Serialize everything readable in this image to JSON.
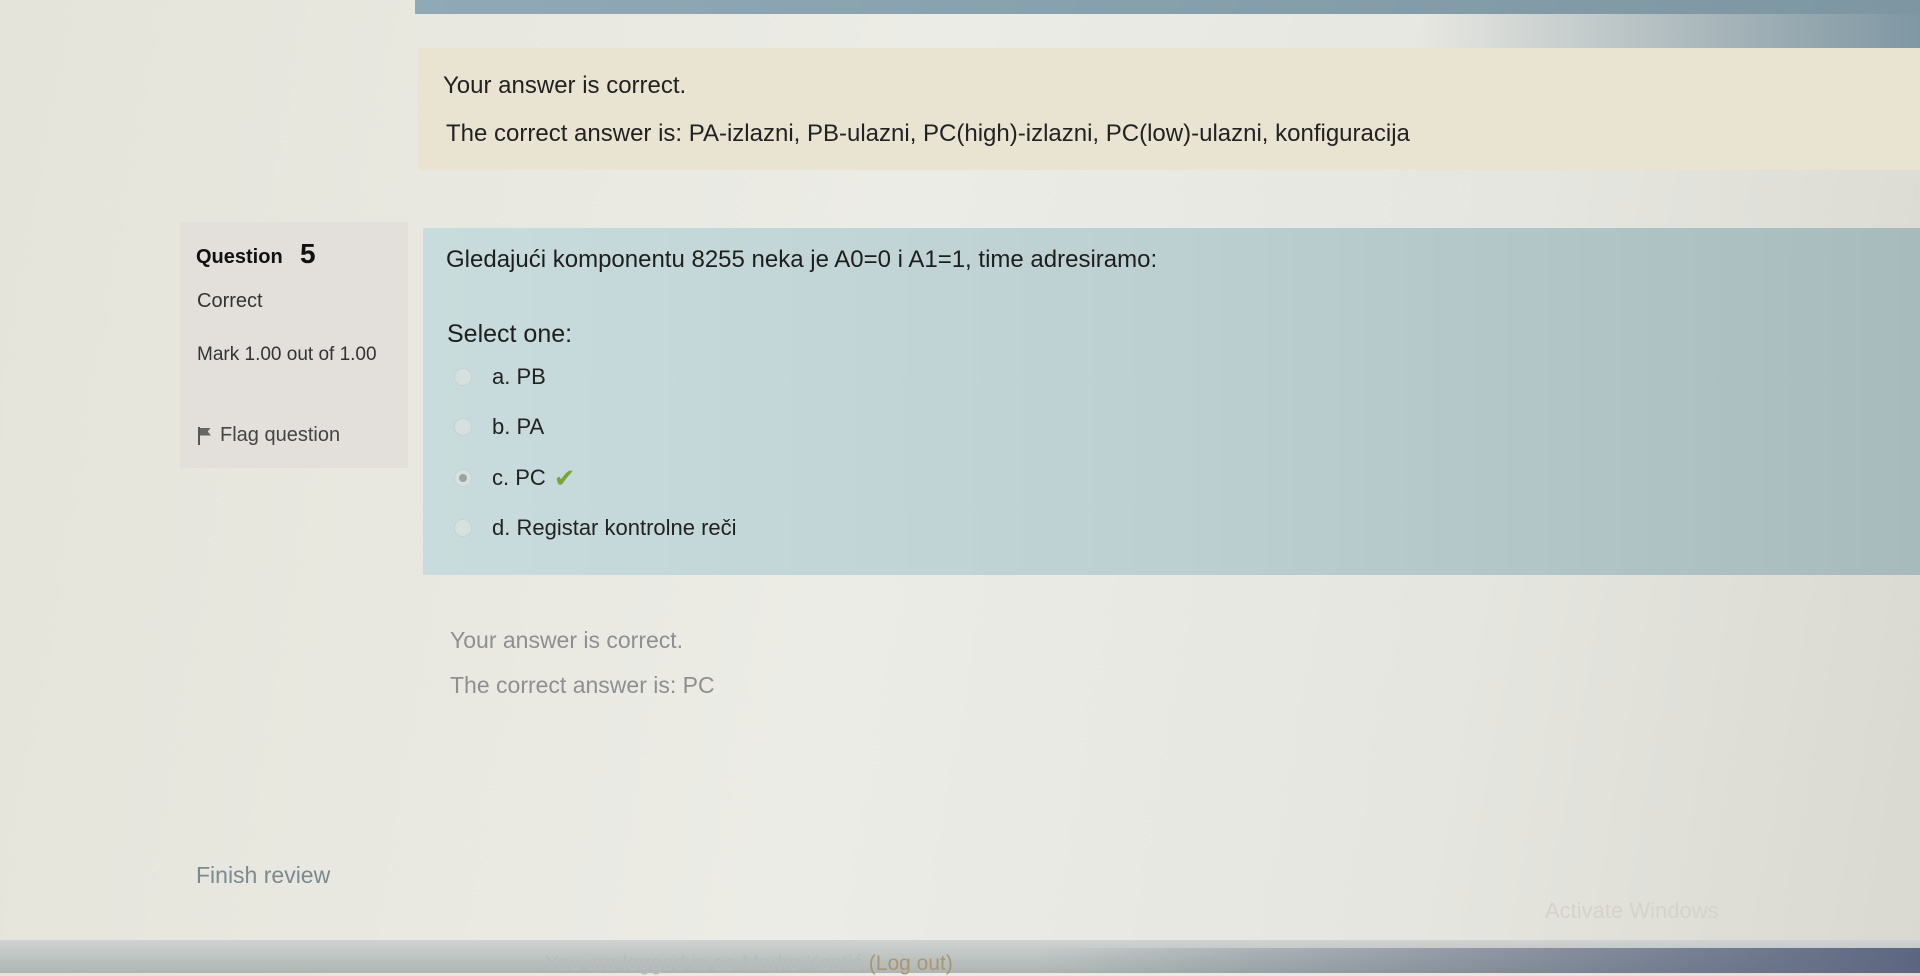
{
  "previous_feedback": {
    "result": "Your answer is correct.",
    "correct_answer": "The correct answer is: PA-izlazni, PB-ulazni, PC(high)-izlazni, PC(low)-ulazni, konfiguracija"
  },
  "question": {
    "label": "Question",
    "number": "5",
    "state": "Correct",
    "grade": "Mark 1.00 out of 1.00",
    "flag_label": "Flag question",
    "text": "Gledajući komponentu 8255 neka je A0=0 i A1=1, time adresiramo:",
    "prompt": "Select one:",
    "options": [
      {
        "label": "a. PB",
        "selected": false,
        "correct": false
      },
      {
        "label": "b. PA",
        "selected": false,
        "correct": false
      },
      {
        "label": "c. PC",
        "selected": true,
        "correct": true
      },
      {
        "label": "d. Registar kontrolne reči",
        "selected": false,
        "correct": false
      }
    ],
    "feedback": {
      "result": "Your answer is correct.",
      "correct_answer": "The correct answer is: PC"
    }
  },
  "finish_review_label": "Finish review",
  "footer": {
    "logged_in_prefix": "You are logged in as Marko Kostić",
    "logout_label": "(Log out)"
  },
  "watermark": "Activate Windows",
  "icons": {
    "flag": "flag-icon",
    "correct": "checkmark-icon"
  },
  "colors": {
    "question_background": "#c9dcdd",
    "feedback_background": "#e9e3d1",
    "info_background": "#e3e0dc",
    "correct_check": "#7ba43a"
  }
}
